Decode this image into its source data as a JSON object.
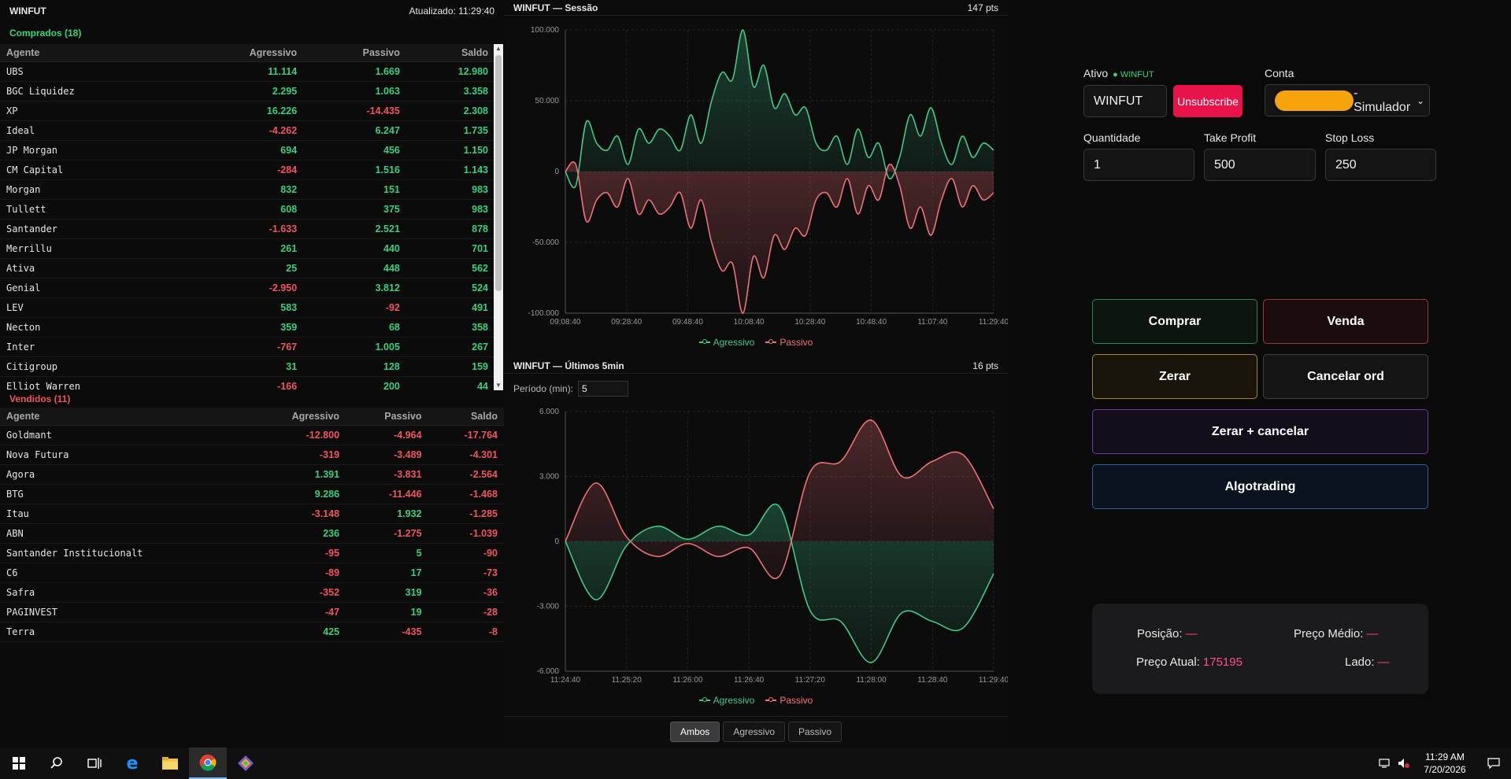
{
  "left": {
    "title": "WINFUT",
    "updated": "Atualizado: 11:29:40",
    "bought_title": "Comprados (18)",
    "sold_title": "Vendidos (11)",
    "headers": [
      "Agente",
      "Agressivo",
      "Passivo",
      "Saldo"
    ],
    "bought": [
      [
        "UBS",
        "11.114",
        "1.669",
        "12.980"
      ],
      [
        "BGC Liquidez",
        "2.295",
        "1.063",
        "3.358"
      ],
      [
        "XP",
        "16.226",
        "-14.435",
        "2.308"
      ],
      [
        "Ideal",
        "-4.262",
        "6.247",
        "1.735"
      ],
      [
        "JP Morgan",
        "694",
        "456",
        "1.150"
      ],
      [
        "CM Capital",
        "-284",
        "1.516",
        "1.143"
      ],
      [
        "Morgan",
        "832",
        "151",
        "983"
      ],
      [
        "Tullett",
        "608",
        "375",
        "983"
      ],
      [
        "Santander",
        "-1.633",
        "2.521",
        "878"
      ],
      [
        "Merrillu",
        "261",
        "440",
        "701"
      ],
      [
        "Ativa",
        "25",
        "448",
        "562"
      ],
      [
        "Genial",
        "-2.950",
        "3.812",
        "524"
      ],
      [
        "LEV",
        "583",
        "-92",
        "491"
      ],
      [
        "Necton",
        "359",
        "68",
        "358"
      ],
      [
        "Inter",
        "-767",
        "1.005",
        "267"
      ],
      [
        "Citigroup",
        "31",
        "128",
        "159"
      ],
      [
        "Elliot Warren",
        "-166",
        "200",
        "44"
      ]
    ],
    "sold": [
      [
        "Goldmant",
        "-12.800",
        "-4.964",
        "-17.764"
      ],
      [
        "Nova Futura",
        "-319",
        "-3.489",
        "-4.301"
      ],
      [
        "Agora",
        "1.391",
        "-3.831",
        "-2.564"
      ],
      [
        "BTG",
        "9.286",
        "-11.446",
        "-1.468"
      ],
      [
        "Itau",
        "-3.148",
        "1.932",
        "-1.285"
      ],
      [
        "ABN",
        "236",
        "-1.275",
        "-1.039"
      ],
      [
        "Santander Institucionalt",
        "-95",
        "5",
        "-90"
      ],
      [
        "C6",
        "-89",
        "17",
        "-73"
      ],
      [
        "Safra",
        "-352",
        "319",
        "-36"
      ],
      [
        "PAGINVEST",
        "-47",
        "19",
        "-28"
      ],
      [
        "Terra",
        "425",
        "-435",
        "-8"
      ]
    ]
  },
  "session_chart": {
    "title": "WINFUT — Sessão",
    "pts": "147 pts"
  },
  "recent_chart": {
    "title": "WINFUT — Últimos 5min",
    "pts": "16 pts",
    "period_label": "Período (min):",
    "period_value": "5"
  },
  "legend": {
    "agressivo": "Agressivo",
    "passivo": "Passivo"
  },
  "toggles": [
    "Ambos",
    "Agressivo",
    "Passivo"
  ],
  "chart_data": [
    {
      "type": "area",
      "title": "WINFUT — Sessão",
      "x_ticks": [
        "09:08:40",
        "09:28:40",
        "09:48:40",
        "10:08:40",
        "10:28:40",
        "10:48:40",
        "11:07:40",
        "11:29:40"
      ],
      "y_ticks": [
        "100.000",
        "50.000",
        "0",
        "-50.000",
        "-100.000"
      ],
      "ylim": [
        -100000,
        100000
      ],
      "series": [
        {
          "name": "Agressivo",
          "color": "#41c98a",
          "values": [
            0,
            -10000,
            35000,
            20000,
            15000,
            25000,
            5000,
            30000,
            20000,
            30000,
            25000,
            15000,
            40000,
            20000,
            50000,
            70000,
            65000,
            100000,
            60000,
            75000,
            45000,
            55000,
            40000,
            45000,
            20000,
            15000,
            25000,
            5000,
            30000,
            10000,
            20000,
            -5000,
            10000,
            40000,
            25000,
            45000,
            20000,
            5000,
            25000,
            10000,
            20000,
            15000
          ]
        },
        {
          "name": "Passivo",
          "color": "#f07077",
          "values": [
            0,
            5000,
            -35000,
            -20000,
            -15000,
            -25000,
            -5000,
            -30000,
            -20000,
            -30000,
            -25000,
            -15000,
            -40000,
            -20000,
            -50000,
            -70000,
            -65000,
            -100000,
            -60000,
            -75000,
            -45000,
            -55000,
            -40000,
            -45000,
            -20000,
            -15000,
            -25000,
            -5000,
            -30000,
            -10000,
            -20000,
            5000,
            -10000,
            -40000,
            -25000,
            -45000,
            -20000,
            -5000,
            -25000,
            -10000,
            -20000,
            -15000
          ]
        }
      ]
    },
    {
      "type": "area",
      "title": "WINFUT — Últimos 5min",
      "x_ticks": [
        "11:24:40",
        "11:25:20",
        "11:26:00",
        "11:26:40",
        "11:27:20",
        "11:28:00",
        "11:28:40",
        "11:29:40"
      ],
      "y_ticks": [
        "6.000",
        "3.000",
        "0",
        "-3.000",
        "-6.000"
      ],
      "ylim": [
        -6000,
        6000
      ],
      "series": [
        {
          "name": "Agressivo",
          "color": "#41c98a",
          "values": [
            0,
            -2700,
            -200,
            700,
            100,
            700,
            300,
            1600,
            -3200,
            -3700,
            -5600,
            -3300,
            -3700,
            -4000,
            -1500
          ]
        },
        {
          "name": "Passivo",
          "color": "#f07077",
          "values": [
            0,
            2700,
            200,
            -700,
            -100,
            -700,
            -300,
            -1600,
            3200,
            3700,
            5600,
            3000,
            3700,
            4000,
            1500
          ]
        }
      ]
    }
  ],
  "right": {
    "ativo_label": "Ativo",
    "ativo_status": "● WINFUT",
    "ativo_value": "WINFUT",
    "unsubscribe": "Unsubscribe",
    "conta_label": "Conta",
    "conta_value": "- Simulador",
    "qty_label": "Quantidade",
    "qty_value": "1",
    "tp_label": "Take Profit",
    "tp_value": "500",
    "sl_label": "Stop Loss",
    "sl_value": "250",
    "btn_comprar": "Comprar",
    "btn_venda": "Venda",
    "btn_zerar": "Zerar",
    "btn_cancelar": "Cancelar ord",
    "btn_zerar_cancelar": "Zerar + cancelar",
    "btn_algo": "Algotrading",
    "posicao_label": "Posição:",
    "posicao_value": "—",
    "preco_medio_label": "Preço Médio:",
    "preco_medio_value": "—",
    "preco_atual_label": "Preço Atual:",
    "preco_atual_value": "175195",
    "lado_label": "Lado:",
    "lado_value": "—"
  },
  "taskbar": {
    "time": "11:29 AM",
    "date": "7/20/2026",
    "icons": [
      "windows-icon",
      "search-icon",
      "task-view-icon",
      "edge-icon",
      "file-explorer-icon",
      "chrome-icon",
      "app-icon"
    ]
  }
}
